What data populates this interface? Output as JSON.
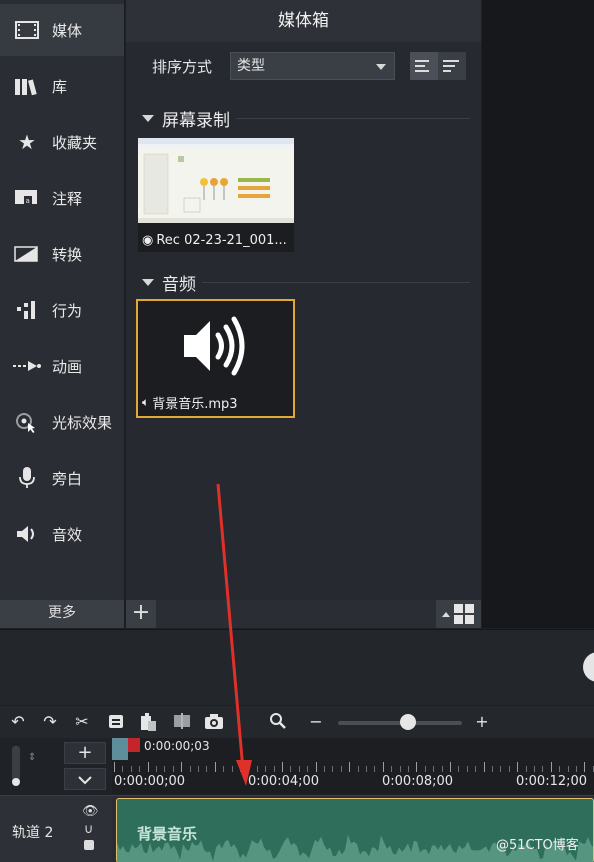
{
  "sidebar": {
    "items": [
      {
        "label": "媒体",
        "icon": "film-icon"
      },
      {
        "label": "库",
        "icon": "library-icon"
      },
      {
        "label": "收藏夹",
        "icon": "star-icon"
      },
      {
        "label": "注释",
        "icon": "annotation-icon"
      },
      {
        "label": "转换",
        "icon": "transition-icon"
      },
      {
        "label": "行为",
        "icon": "behavior-icon"
      },
      {
        "label": "动画",
        "icon": "animation-icon"
      },
      {
        "label": "光标效果",
        "icon": "cursor-effect-icon"
      },
      {
        "label": "旁白",
        "icon": "microphone-icon"
      },
      {
        "label": "音效",
        "icon": "audio-effect-icon"
      }
    ],
    "more_label": "更多"
  },
  "bin": {
    "title": "媒体箱",
    "sort_label": "排序方式",
    "sort_value": "类型",
    "sections": [
      {
        "title": "屏幕录制",
        "item_label": "Rec 02-23-21_001..."
      },
      {
        "title": "音频",
        "item_label": "背景音乐.mp3"
      }
    ]
  },
  "timeline": {
    "playhead_time": "0:00:00;03",
    "ruler_labels": [
      "0:00:00;00",
      "0:00:04;00",
      "0:00:08;00",
      "0:00:12;00"
    ],
    "track_label": "轨道 2",
    "clip_title": "背景音乐"
  },
  "watermark": "@51CTO博客",
  "colors": {
    "accent_selected": "#e3a736",
    "clip": "#2f6e5a",
    "annotation_arrow": "#e0302a"
  }
}
